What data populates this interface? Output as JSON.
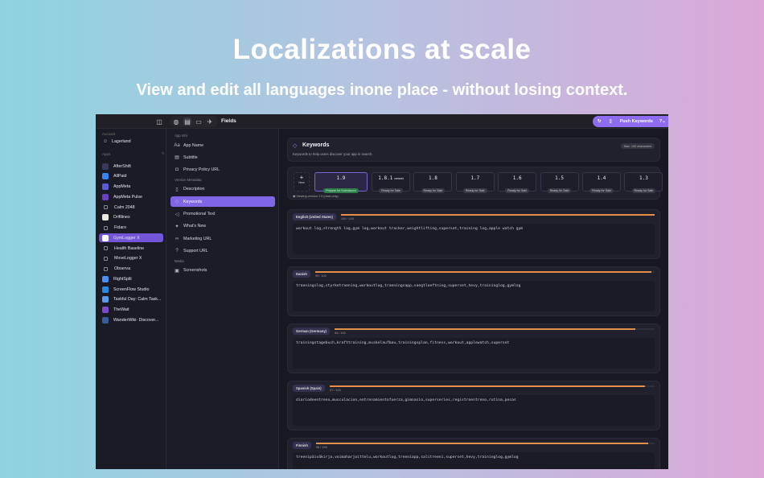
{
  "hero": {
    "title": "Localizations at scale",
    "subtitle": "View and edit all languages inone place - without losing context."
  },
  "toolbar": {
    "fields_label": "Fields",
    "push_label": "Push Keywords"
  },
  "sidebar": {
    "account_label": "Account",
    "account_name": "Lagerland",
    "apps_label": "Apps",
    "apps": [
      {
        "name": "AfterShift",
        "color": "#3a3a60",
        "icon": true
      },
      {
        "name": "AllPaid",
        "color": "#3b82f6",
        "icon": true
      },
      {
        "name": "AppMeta",
        "color": "#5b5bd6",
        "icon": true
      },
      {
        "name": "AppMeta Pulse",
        "color": "#6a3fc0",
        "icon": true
      },
      {
        "name": "Calm 2048",
        "color": "",
        "icon": false
      },
      {
        "name": "Driftlines",
        "color": "#e8e6df",
        "icon": true
      },
      {
        "name": "Fidaro",
        "color": "",
        "icon": false
      },
      {
        "name": "GymLogger X",
        "color": "#ffffff",
        "icon": true,
        "selected": true
      },
      {
        "name": "Health Baseline",
        "color": "",
        "icon": false
      },
      {
        "name": "MoveLogger X",
        "color": "",
        "icon": false
      },
      {
        "name": "Observa",
        "color": "",
        "icon": false
      },
      {
        "name": "RightSplit",
        "color": "#4d8ff0",
        "icon": true
      },
      {
        "name": "ScreenFlow Studio",
        "color": "#2b8ae0",
        "icon": true
      },
      {
        "name": "Taskful Day: Calm Task...",
        "color": "#5a9ae8",
        "icon": true
      },
      {
        "name": "TheWait",
        "color": "#7a4cc8",
        "icon": true
      },
      {
        "name": "WanderWiki- Discover...",
        "color": "#3a5a9a",
        "icon": true
      }
    ]
  },
  "fields": {
    "sections": [
      {
        "label": "App Info",
        "items": [
          {
            "label": "App Name",
            "icon": "Aa"
          },
          {
            "label": "Subtitle",
            "icon": "▤"
          },
          {
            "label": "Privacy Policy URL",
            "icon": "◘"
          }
        ]
      },
      {
        "label": "Version Metadata",
        "items": [
          {
            "label": "Description",
            "icon": "▯"
          },
          {
            "label": "Keywords",
            "icon": "◇",
            "selected": true
          },
          {
            "label": "Promotional Text",
            "icon": "◁"
          },
          {
            "label": "What's New",
            "icon": "✦"
          },
          {
            "label": "Marketing URL",
            "icon": "∞"
          },
          {
            "label": "Support URL",
            "icon": "?"
          }
        ]
      },
      {
        "label": "Media",
        "items": [
          {
            "label": "Screenshots",
            "icon": "▣"
          }
        ]
      }
    ]
  },
  "keywords": {
    "title": "Keywords",
    "subtitle": "Keywords to help users discover your app in search.",
    "max": "Max: 100 characters"
  },
  "versions": {
    "new_label": "New",
    "viewing": "Viewing version 1.9 (read-only)",
    "items": [
      {
        "num": "1.9",
        "status": "Prepare for Submission",
        "current": true
      },
      {
        "num": "1.8.1",
        "tag": "newest",
        "status": "Ready for Sale"
      },
      {
        "num": "1.8",
        "status": "Ready for Sale"
      },
      {
        "num": "1.7",
        "status": "Ready for Sale"
      },
      {
        "num": "1.6",
        "status": "Ready for Sale"
      },
      {
        "num": "1.5",
        "status": "Ready for Sale"
      },
      {
        "num": "1.4",
        "status": "Ready for Sale"
      },
      {
        "num": "1.3",
        "status": "Ready for Sale"
      }
    ]
  },
  "locales": [
    {
      "lang": "English (United States)",
      "count": "100 / 100",
      "used": 100,
      "text": "workout log,strength log,gym log,workout tracker,weightlifting,superset,training log,apple watch gym"
    },
    {
      "lang": "Danish",
      "count": "99 / 100",
      "used": 99,
      "text": "traeningslog,styrketraening,workoutlog,traeningsapp,vaegtloeftning,superset,hevy,traininglog,gymlog"
    },
    {
      "lang": "German (Germany)",
      "count": "94 / 100",
      "used": 94,
      "text": "trainingstagebuch,krafttraining,muskelaufbau,trainingsplan,fitness,workout,applewatch,superset"
    },
    {
      "lang": "Spanish (Spain)",
      "count": "97 / 100",
      "used": 97,
      "text": "diariodeentreno,musculacion,entrenamientofuerza,gimnasio,superseries,registroentreno,rutina,pesas"
    },
    {
      "lang": "Finnish",
      "count": "98 / 100",
      "used": 98,
      "text": "treenipäiväkirja,voimaharjoittelu,workoutlog,treeniapp,salitreeni,superset,hevy,traininglog,gymlog"
    }
  ]
}
